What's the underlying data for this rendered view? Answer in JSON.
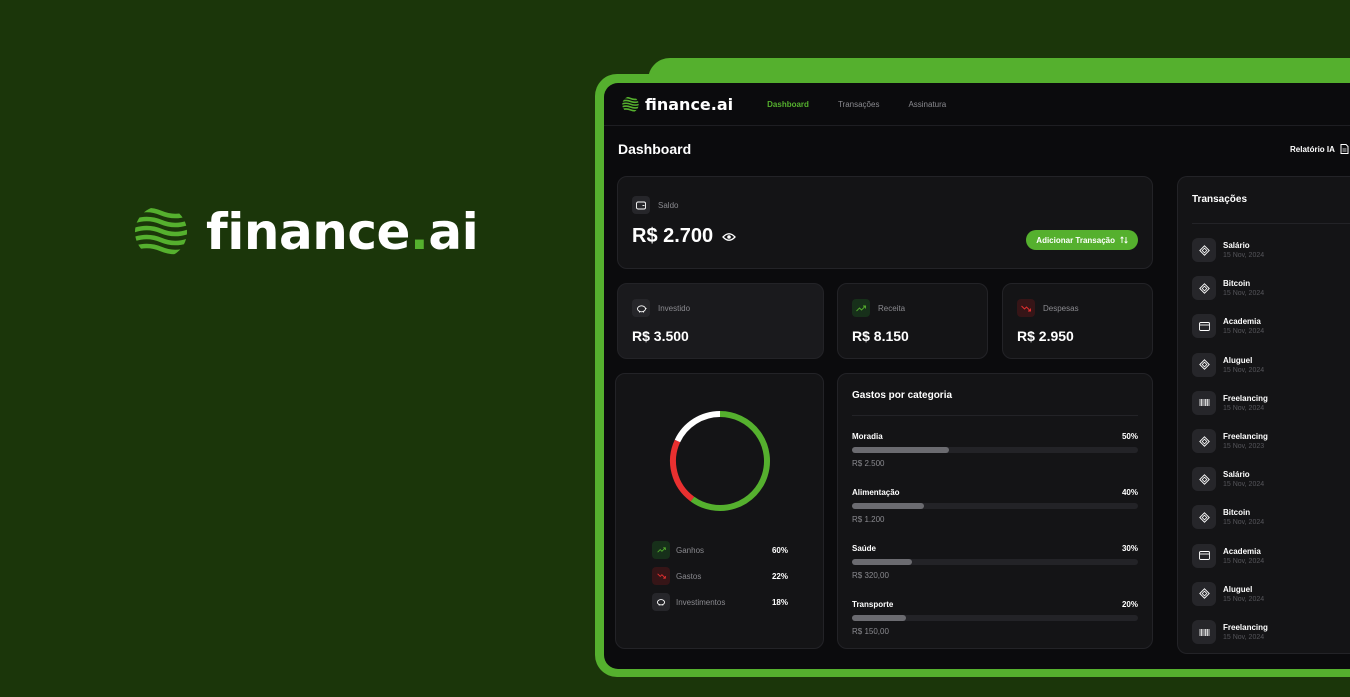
{
  "hero": {
    "brand": "finance",
    "brand_dot": ".",
    "brand_suffix": "ai"
  },
  "nav": {
    "brand": "finance.ai",
    "links": [
      {
        "label": "Dashboard",
        "active": true
      },
      {
        "label": "Transações",
        "active": false
      },
      {
        "label": "Assinatura",
        "active": false
      }
    ]
  },
  "page": {
    "title": "Dashboard",
    "report_label": "Relatório IA"
  },
  "balance": {
    "label": "Saldo",
    "value": "R$ 2.700",
    "add_label": "Adicionar Transação"
  },
  "summary": [
    {
      "label": "Investido",
      "value": "R$ 3.500",
      "icon": "piggy-bank-icon"
    },
    {
      "label": "Receita",
      "value": "R$ 8.150",
      "icon": "trending-up-icon"
    },
    {
      "label": "Despesas",
      "value": "R$ 2.950",
      "icon": "trending-down-icon"
    }
  ],
  "donut": {
    "segments": [
      {
        "name": "Ganhos",
        "percent": 60,
        "color": "#55b02e"
      },
      {
        "name": "Gastos",
        "percent": 22,
        "color": "#e93030"
      },
      {
        "name": "Investimentos",
        "percent": 18,
        "color": "#ffffff"
      }
    ],
    "legend": [
      {
        "name": "Ganhos",
        "pct": "60%"
      },
      {
        "name": "Gastos",
        "pct": "22%"
      },
      {
        "name": "Investimentos",
        "pct": "18%"
      }
    ]
  },
  "categories": {
    "title": "Gastos por categoria",
    "items": [
      {
        "name": "Moradia",
        "pct": "50%",
        "amount": "R$ 2.500",
        "fill": 0.34
      },
      {
        "name": "Alimentação",
        "pct": "40%",
        "amount": "R$ 1.200",
        "fill": 0.25
      },
      {
        "name": "Saúde",
        "pct": "30%",
        "amount": "R$ 320,00",
        "fill": 0.21
      },
      {
        "name": "Transporte",
        "pct": "20%",
        "amount": "R$ 150,00",
        "fill": 0.19
      }
    ]
  },
  "transactions": {
    "title": "Transações",
    "items": [
      {
        "name": "Salário",
        "date": "15 Nov, 2024",
        "icon": "pix-icon"
      },
      {
        "name": "Bitcoin",
        "date": "15 Nov, 2024",
        "icon": "pix-icon"
      },
      {
        "name": "Academia",
        "date": "15 Nov, 2024",
        "icon": "card-icon"
      },
      {
        "name": "Aluguel",
        "date": "15 Nov, 2024",
        "icon": "pix-icon"
      },
      {
        "name": "Freelancing",
        "date": "15 Nov, 2024",
        "icon": "barcode-icon"
      },
      {
        "name": "Freelancing",
        "date": "15 Nov, 2023",
        "icon": "pix-icon"
      },
      {
        "name": "Salário",
        "date": "15 Nov, 2024",
        "icon": "pix-icon"
      },
      {
        "name": "Bitcoin",
        "date": "15 Nov, 2024",
        "icon": "pix-icon"
      },
      {
        "name": "Academia",
        "date": "15 Nov, 2024",
        "icon": "card-icon"
      },
      {
        "name": "Aluguel",
        "date": "15 Nov, 2024",
        "icon": "pix-icon"
      },
      {
        "name": "Freelancing",
        "date": "15 Nov, 2024",
        "icon": "barcode-icon"
      }
    ]
  },
  "colors": {
    "accent": "#55b02e",
    "background": "#1b360a",
    "danger": "#e93030"
  }
}
